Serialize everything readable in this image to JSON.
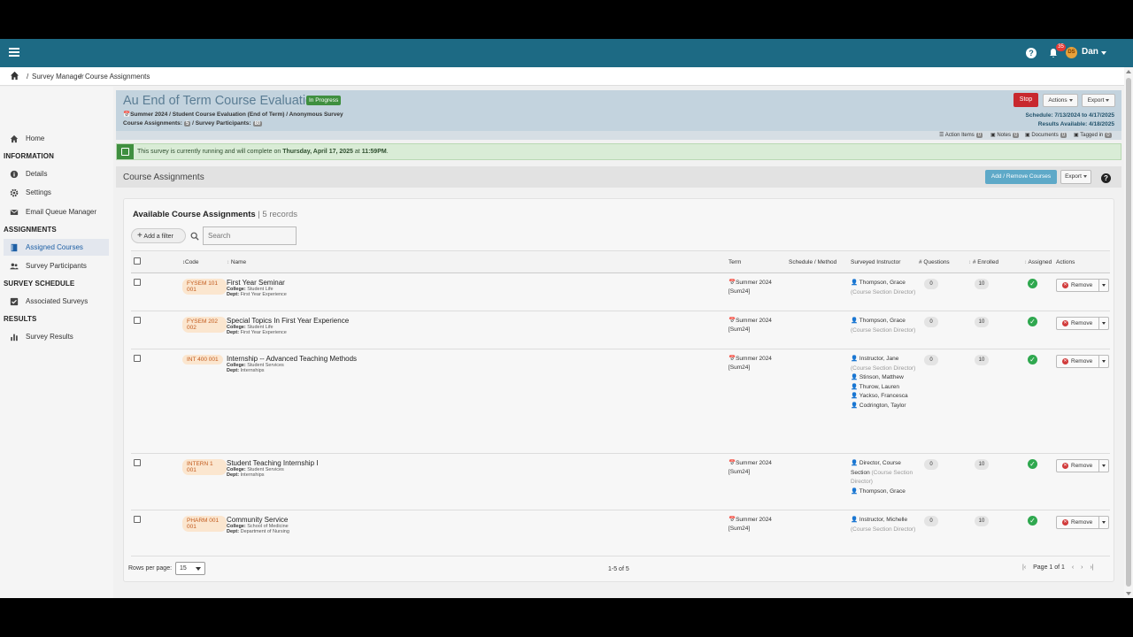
{
  "topbar": {
    "notifications": "35",
    "avatar_initials": "DS",
    "user_name": "Dan"
  },
  "breadcrumb": {
    "items": [
      "Survey Manager",
      "Course Assignments"
    ]
  },
  "sidebar": {
    "home": "Home",
    "info_head": "INFORMATION",
    "details": "Details",
    "settings": "Settings",
    "email_queue": "Email Queue Manager",
    "assign_head": "ASSIGNMENTS",
    "assigned_courses": "Assigned Courses",
    "survey_participants": "Survey Participants",
    "schedule_head": "SURVEY SCHEDULE",
    "associated_surveys": "Associated Surveys",
    "results_head": "RESULTS",
    "survey_results": "Survey Results"
  },
  "header": {
    "title": "Au End of Term Course Evaluation 3",
    "status": "In Progress",
    "subtitle": "Summer 2024 / Student Course Evaluation  (End of Term)  / Anonymous Survey",
    "course_assignments_label": "Course Assignments:",
    "course_assignments_count": "5",
    "participants_label": "/ Survey Participants:",
    "participants_count": "80",
    "stop": "Stop",
    "actions": "Actions",
    "export": "Export",
    "schedule": "Schedule: 7/13/2024 to 4/17/2025",
    "results": "Results Available: 4/18/2025",
    "action_items": "Action Items",
    "action_items_count": "0",
    "notes": "Notes",
    "notes_count": "0",
    "documents": "Documents",
    "documents_count": "0",
    "tagged": "Tagged in",
    "tagged_count": "0"
  },
  "info": {
    "text_pre": "This survey is currently running and will complete on ",
    "date": "Thursday, April 17, 2025",
    "text_mid": " at ",
    "time": "11:59PM",
    "text_post": "."
  },
  "section": {
    "title": "Course Assignments",
    "add_remove": "Add / Remove Courses",
    "export": "Export"
  },
  "table": {
    "title": "Available Course Assignments",
    "records": "| 5 records",
    "add_filter": "Add a filter",
    "search_placeholder": "Search",
    "headers": {
      "code": "Code",
      "name": "Name",
      "term": "Term",
      "schedule": "Schedule / Method",
      "instructor": "Surveyed Instructor",
      "questions": "# Questions",
      "enrolled": "# Enrolled",
      "assigned": "Assigned",
      "actions": "Actions"
    },
    "remove_label": "Remove",
    "college_label": "College:",
    "dept_label": "Dept:",
    "rows": [
      {
        "code": "FYSEM 101 001",
        "name": "First Year Seminar",
        "college": "Student Life",
        "dept": "First Year Experience",
        "term": "Summer 2024",
        "term_code": "[Sum24]",
        "instructors": [
          {
            "name": "Thompson, Grace",
            "role": "(Course Section Director)"
          }
        ],
        "questions": "0",
        "enrolled": "10"
      },
      {
        "code": "FYSEM 202 002",
        "name": "Special Topics In First Year Experience",
        "college": "Student Life",
        "dept": "First Year Experience",
        "term": "Summer 2024",
        "term_code": "[Sum24]",
        "instructors": [
          {
            "name": "Thompson, Grace",
            "role": "(Course Section Director)"
          }
        ],
        "questions": "0",
        "enrolled": "10"
      },
      {
        "code": "INT 400 001",
        "name": "Internship -- Advanced Teaching Methods",
        "college": "Student Services",
        "dept": "Internships",
        "term": "Summer 2024",
        "term_code": "[Sum24]",
        "instructors": [
          {
            "name": "Instructor, Jane",
            "role": "(Course Section Director)"
          },
          {
            "name": "Stinson, Matthew",
            "role": ""
          },
          {
            "name": "Thurow, Lauren",
            "role": ""
          },
          {
            "name": "Yackso, Francesca",
            "role": ""
          },
          {
            "name": "Codrington, Taylor",
            "role": ""
          }
        ],
        "questions": "0",
        "enrolled": "10"
      },
      {
        "code": "INTERN 1 001",
        "name": "Student Teaching Internship I",
        "college": "Student Services",
        "dept": "Internships",
        "term": "Summer 2024",
        "term_code": "[Sum24]",
        "instructors": [
          {
            "name": "Director, Course Section",
            "role": "(Course Section Director)"
          },
          {
            "name": "Thompson, Grace",
            "role": ""
          }
        ],
        "questions": "0",
        "enrolled": "10"
      },
      {
        "code": "PHARM 001 001",
        "name": "Community Service",
        "college": "School of Medicine",
        "dept": "Department of Nursing",
        "term": "Summer 2024",
        "term_code": "[Sum24]",
        "instructors": [
          {
            "name": "Instructor, Michelle",
            "role": "(Course Section Director)"
          }
        ],
        "questions": "0",
        "enrolled": "10"
      }
    ]
  },
  "footer": {
    "rows_per_page_label": "Rows per page:",
    "rows_per_page": "15",
    "range": "1-5 of 5",
    "page": "Page 1 of 1"
  }
}
